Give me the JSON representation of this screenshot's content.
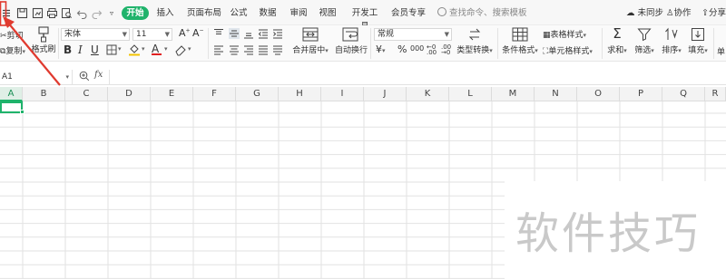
{
  "menu_tabs": [
    "开始",
    "插入",
    "页面布局",
    "公式",
    "数据",
    "审阅",
    "视图",
    "开发工具",
    "会员专享"
  ],
  "search_placeholder": "查找命令、搜索模板",
  "right_actions": {
    "sync": "未同步",
    "collab": "协作",
    "share": "分享"
  },
  "ribbon": {
    "cut": "剪切",
    "copy": "复制",
    "format_painter": "格式刷",
    "font_name": "宋体",
    "font_size": "11",
    "merge_center": "合并居中",
    "wrap_text": "自动换行",
    "number_format": "常规",
    "type_convert": "类型转换",
    "cond_format": "条件格式",
    "table_style": "表格样式",
    "cell_style": "单元格样式",
    "sum": "求和",
    "filter": "筛选",
    "sort": "排序",
    "fill": "填充",
    "single": "单",
    "currency": "¥",
    "percent": "%",
    "thousands": "000",
    "bold": "B",
    "italic": "I",
    "underline": "U",
    "font_grow": "A",
    "font_shrink": "A",
    "font_color": "A",
    "fill_color_label": "填充色"
  },
  "formula_bar": {
    "name_box": "A1",
    "fx": "fx"
  },
  "columns": [
    "A",
    "B",
    "C",
    "D",
    "E",
    "F",
    "G",
    "H",
    "I",
    "J",
    "K",
    "L",
    "M",
    "N",
    "O",
    "P",
    "Q",
    "R"
  ],
  "selected_cell": "A1",
  "watermark": "软件技巧",
  "colors": {
    "accent": "#1fb36b",
    "arrow": "#e03a2f"
  }
}
